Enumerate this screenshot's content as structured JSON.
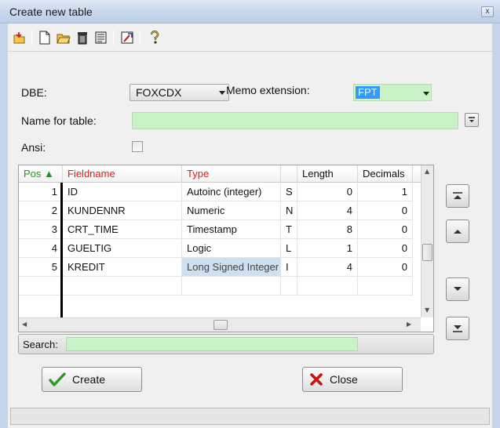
{
  "window": {
    "title": "Create new table",
    "close_glyph": "x"
  },
  "toolbar": {
    "items": [
      {
        "name": "open-table-icon"
      },
      {
        "name": "new-document-icon"
      },
      {
        "name": "open-folder-icon"
      },
      {
        "name": "delete-icon"
      },
      {
        "name": "properties-icon"
      },
      {
        "name": "edit-structure-icon"
      },
      {
        "name": "help-icon"
      }
    ]
  },
  "form": {
    "dbe_label": "DBE:",
    "dbe_value": "FOXCDX",
    "memo_label": "Memo extension:",
    "memo_value": "FPT",
    "name_label": "Name for table:",
    "name_value": "",
    "ansi_label": "Ansi:",
    "ansi_checked": false
  },
  "grid": {
    "headers": {
      "pos": "Pos ▲",
      "fieldname": "Fieldname",
      "type": "Type",
      "code": "",
      "length": "Length",
      "decimals": "Decimals"
    },
    "rows": [
      {
        "pos": "1",
        "fieldname": "ID",
        "type": "Autoinc (integer)",
        "code": "S",
        "length": "0",
        "decimals": "1"
      },
      {
        "pos": "2",
        "fieldname": "KUNDENNR",
        "type": "Numeric",
        "code": "N",
        "length": "4",
        "decimals": "0"
      },
      {
        "pos": "3",
        "fieldname": "CRT_TIME",
        "type": "Timestamp",
        "code": "T",
        "length": "8",
        "decimals": "0"
      },
      {
        "pos": "4",
        "fieldname": "GUELTIG",
        "type": "Logic",
        "code": "L",
        "length": "1",
        "decimals": "0"
      },
      {
        "pos": "5",
        "fieldname": "KREDIT",
        "type": "Long Signed Integer",
        "code": "I",
        "length": "4",
        "decimals": "0"
      }
    ]
  },
  "search": {
    "label": "Search:",
    "value": ""
  },
  "buttons": {
    "create": "Create",
    "close": "Close"
  },
  "colors": {
    "field_green": "#c9f3c6",
    "header_red": "#e21b1b",
    "header_green": "#1a9e1a",
    "selection_blue": "#3399ff"
  }
}
